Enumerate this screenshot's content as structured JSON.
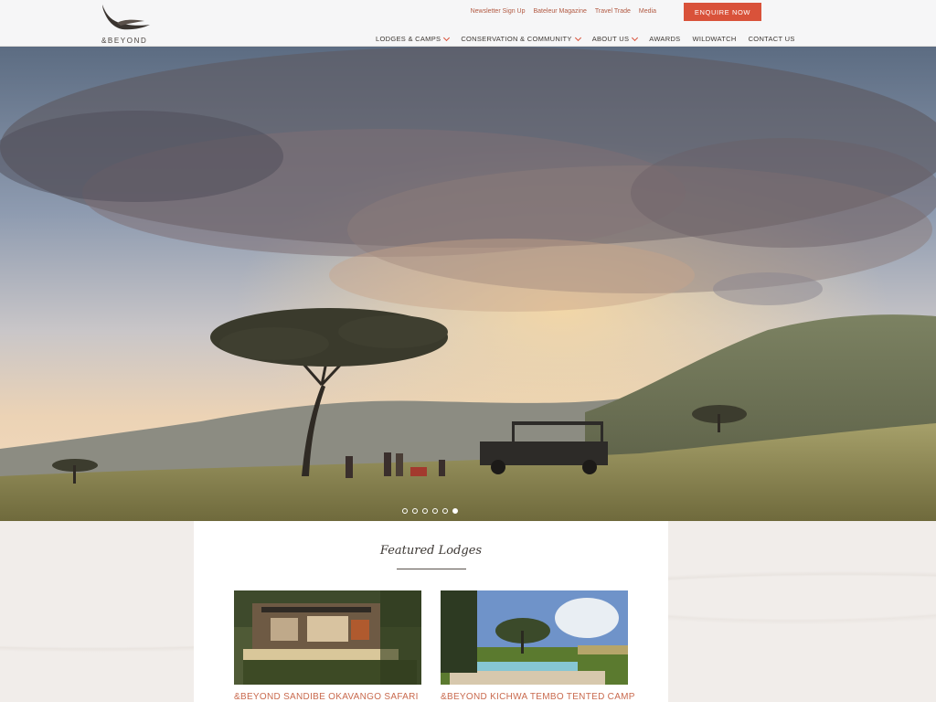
{
  "brand": {
    "name": "&BEYOND"
  },
  "utility_links": [
    "Newsletter Sign Up",
    "Bateleur Magazine",
    "Travel Trade",
    "Media"
  ],
  "cta": {
    "label": "ENQUIRE NOW"
  },
  "nav": [
    {
      "label": "LODGES & CAMPS",
      "dropdown": true
    },
    {
      "label": "CONSERVATION & COMMUNITY",
      "dropdown": true
    },
    {
      "label": "ABOUT US",
      "dropdown": true
    },
    {
      "label": "AWARDS",
      "dropdown": false
    },
    {
      "label": "WILDWATCH",
      "dropdown": false
    },
    {
      "label": "CONTACT US",
      "dropdown": false
    }
  ],
  "slider": {
    "count": 6,
    "active": 6
  },
  "featured": {
    "title": "Featured Lodges",
    "cards": [
      {
        "name": "&BEYOND SANDIBE OKAVANGO SAFARI"
      },
      {
        "name": "&BEYOND KICHWA TEMBO TENTED CAMP"
      }
    ]
  },
  "colors": {
    "accent": "#d9523a",
    "link": "#b25a43",
    "card_title": "#c96a4e"
  }
}
